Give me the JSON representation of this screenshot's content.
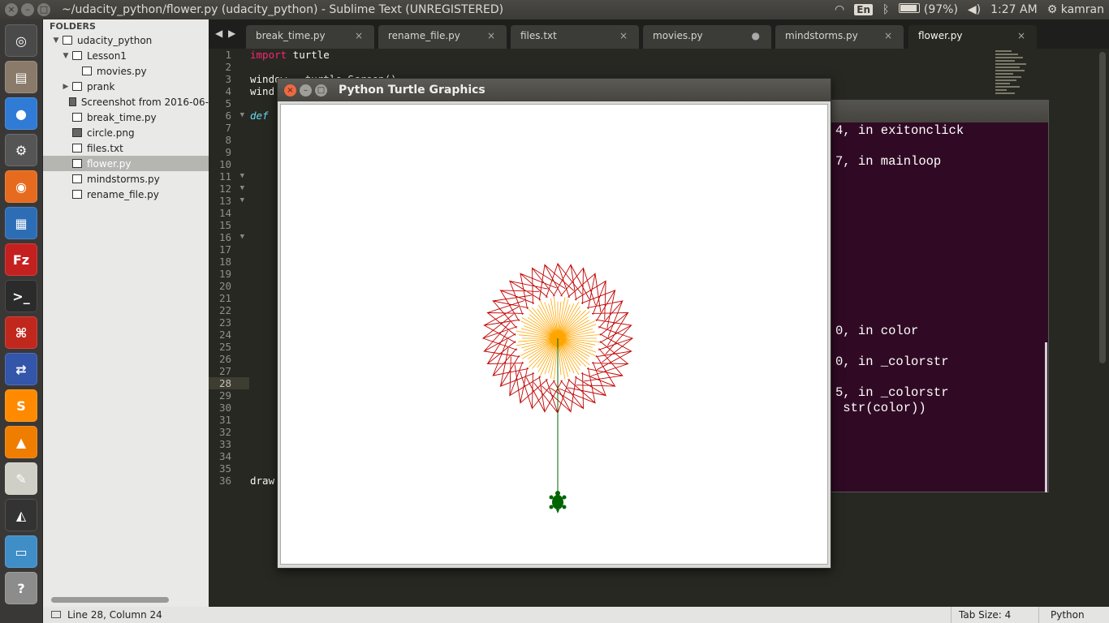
{
  "window_title": "~/udacity_python/flower.py (udacity_python) - Sublime Text (UNREGISTERED)",
  "indicators": {
    "lang": "En",
    "battery": "(97%)",
    "time": "1:27 AM",
    "user": "kamran"
  },
  "launcher": [
    {
      "name": "ubuntu-dash-icon",
      "color": "#4a4a4a",
      "glyph": "◎"
    },
    {
      "name": "files-icon",
      "color": "#8a7a6a",
      "glyph": "▤"
    },
    {
      "name": "chrome-icon",
      "color": "#2f7bd6",
      "glyph": "●"
    },
    {
      "name": "settings-icon",
      "color": "#555",
      "glyph": "⚙"
    },
    {
      "name": "firefox-icon",
      "color": "#e66b1f",
      "glyph": "◉"
    },
    {
      "name": "writer-icon",
      "color": "#2d6db5",
      "glyph": "▦"
    },
    {
      "name": "filezilla-icon",
      "color": "#c4201f",
      "glyph": "Fz"
    },
    {
      "name": "terminal-icon",
      "color": "#2b2b2b",
      "glyph": ">_"
    },
    {
      "name": "acrobat-icon",
      "color": "#c1271d",
      "glyph": "⌘"
    },
    {
      "name": "network-icon",
      "color": "#3355aa",
      "glyph": "⇄"
    },
    {
      "name": "sublime-icon",
      "color": "#ff8a00",
      "glyph": "S"
    },
    {
      "name": "vlc-icon",
      "color": "#ef7d00",
      "glyph": "▲"
    },
    {
      "name": "text-editor-icon",
      "color": "#cfcfc8",
      "glyph": "✎"
    },
    {
      "name": "inkscape-icon",
      "color": "#333",
      "glyph": "◭"
    },
    {
      "name": "workspace-icon",
      "color": "#3f8ec7",
      "glyph": "▭"
    },
    {
      "name": "help-icon",
      "color": "#8c8c8c",
      "glyph": "?"
    }
  ],
  "sidebar": {
    "header": "FOLDERS",
    "items": [
      {
        "label": "udacity_python",
        "indent": 0,
        "tri": "▼",
        "type": "folder",
        "selected": false
      },
      {
        "label": "Lesson1",
        "indent": 1,
        "tri": "▼",
        "type": "folder",
        "selected": false
      },
      {
        "label": "movies.py",
        "indent": 2,
        "tri": "",
        "type": "file",
        "selected": false
      },
      {
        "label": "prank",
        "indent": 1,
        "tri": "▶",
        "type": "folder",
        "selected": false
      },
      {
        "label": "Screenshot from 2016-06-",
        "indent": 1,
        "tri": "",
        "type": "image",
        "selected": false
      },
      {
        "label": "break_time.py",
        "indent": 1,
        "tri": "",
        "type": "file",
        "selected": false
      },
      {
        "label": "circle.png",
        "indent": 1,
        "tri": "",
        "type": "image",
        "selected": false
      },
      {
        "label": "files.txt",
        "indent": 1,
        "tri": "",
        "type": "file",
        "selected": false
      },
      {
        "label": "flower.py",
        "indent": 1,
        "tri": "",
        "type": "file",
        "selected": true
      },
      {
        "label": "mindstorms.py",
        "indent": 1,
        "tri": "",
        "type": "file",
        "selected": false
      },
      {
        "label": "rename_file.py",
        "indent": 1,
        "tri": "",
        "type": "file",
        "selected": false
      }
    ]
  },
  "tabs": [
    {
      "label": "break_time.py",
      "close": "×",
      "active": false
    },
    {
      "label": "rename_file.py",
      "close": "×",
      "active": false
    },
    {
      "label": "files.txt",
      "close": "×",
      "active": false
    },
    {
      "label": "movies.py",
      "close": "●",
      "active": false
    },
    {
      "label": "mindstorms.py",
      "close": "×",
      "active": false
    },
    {
      "label": "flower.py",
      "close": "×",
      "active": true
    }
  ],
  "tab_nav": {
    "left": "◀",
    "right": "▶"
  },
  "code": {
    "line1_kw": "import",
    "line1_rest": " turtle",
    "line3": "window = turtle.Screen()",
    "line4": "wind",
    "line6_kw": "def",
    "line35": "draw"
  },
  "line_count": 36,
  "current_line": 28,
  "fold_lines": [
    6,
    11,
    12,
    13,
    16
  ],
  "terminal_lines": [
    "4, in exitonclick",
    "7, in mainloop",
    "0, in color",
    "0, in _colorstr",
    "5, in _colorstr",
    " str(color))"
  ],
  "turtle_window": {
    "title": "Python Turtle Graphics",
    "close_glyph": "×",
    "min_glyph": "–",
    "max_glyph": "□"
  },
  "flower": {
    "petal_color": "#c00000",
    "center_color": "#ffa500",
    "stem_color": "#006400",
    "turtle_color": "#006400"
  },
  "status": {
    "position": "Line 28, Column 24",
    "tab_size": "Tab Size: 4",
    "syntax": "Python"
  }
}
